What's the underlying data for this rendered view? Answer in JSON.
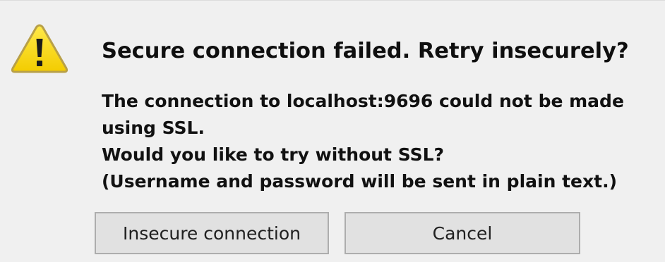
{
  "dialog": {
    "icon": "warning-icon",
    "title": "Secure connection failed. Retry insecurely?",
    "message_lines": [
      "The connection to localhost:9696 could not be made",
      "using SSL.",
      "Would you like to try without SSL?",
      "(Username and password will be sent in plain text.)"
    ],
    "buttons": {
      "insecure_label": "Insecure connection",
      "cancel_label": "Cancel"
    }
  },
  "colors": {
    "dialog_background": "#f0f0f0",
    "button_background": "#e1e1e1",
    "button_border": "#adadad",
    "warning_yellow": "#f5d200",
    "warning_outline": "#b8a048"
  }
}
